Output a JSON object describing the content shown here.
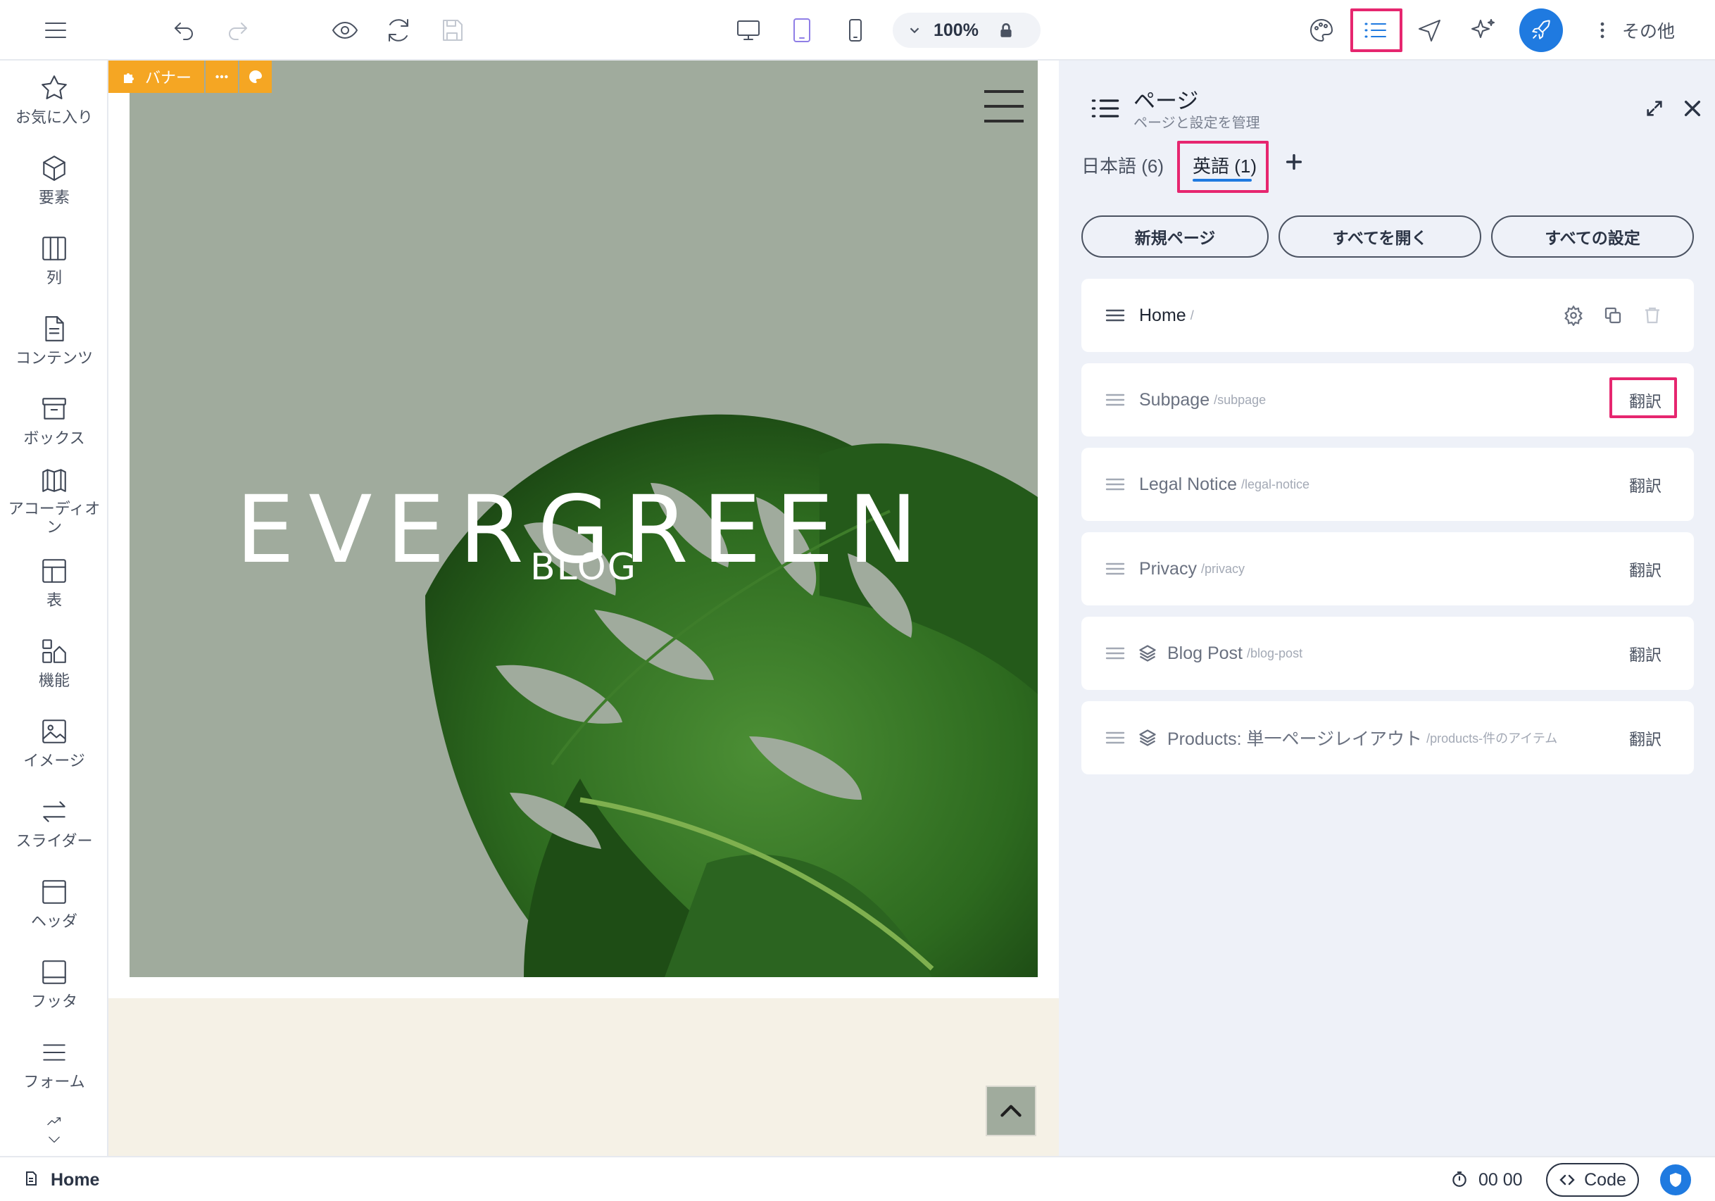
{
  "toolbar": {
    "zoom": "100%",
    "more_label": "その他"
  },
  "sidebar": {
    "items": [
      {
        "label": "お気に入り",
        "icon": "star-icon"
      },
      {
        "label": "要素",
        "icon": "cube-icon"
      },
      {
        "label": "列",
        "icon": "columns-icon"
      },
      {
        "label": "コンテンツ",
        "icon": "document-icon"
      },
      {
        "label": "ボックス",
        "icon": "archive-box-icon"
      },
      {
        "label": "アコーディオン",
        "icon": "accordion-icon"
      },
      {
        "label": "表",
        "icon": "table-icon"
      },
      {
        "label": "機能",
        "icon": "features-icon"
      },
      {
        "label": "イメージ",
        "icon": "image-icon"
      },
      {
        "label": "スライダー",
        "icon": "slider-arrows-icon"
      },
      {
        "label": "ヘッダ",
        "icon": "header-icon"
      },
      {
        "label": "フッタ",
        "icon": "footer-icon"
      },
      {
        "label": "フォーム",
        "icon": "form-lines-icon"
      }
    ]
  },
  "canvas": {
    "element_tag": "バナー",
    "banner_title": "EVERGREEN",
    "banner_subtitle": "BLOG"
  },
  "panel": {
    "title": "ページ",
    "subtitle": "ページと設定を管理",
    "tabs": [
      {
        "label": "日本語 (6)",
        "active": false
      },
      {
        "label": "英語 (1)",
        "active": true
      }
    ],
    "buttons": {
      "new_page": "新規ページ",
      "open_all": "すべてを開く",
      "all_settings": "すべての設定"
    },
    "pages": [
      {
        "name": "Home",
        "slug": "/",
        "action": ""
      },
      {
        "name": "Subpage",
        "slug": "/subpage",
        "action": "翻訳"
      },
      {
        "name": "Legal Notice",
        "slug": "/legal-notice",
        "action": "翻訳"
      },
      {
        "name": "Privacy",
        "slug": "/privacy",
        "action": "翻訳"
      },
      {
        "name": "Blog Post",
        "slug": "/blog-post",
        "action": "翻訳"
      },
      {
        "name": "Products: 単一ページレイアウト",
        "slug": "/products-件のアイテム",
        "action": "翻訳"
      }
    ]
  },
  "footer": {
    "page": "Home",
    "timer": "00 00",
    "code_label": "Code"
  },
  "colors": {
    "highlight": "#e6266f",
    "accent": "#1f7ae0",
    "tag": "#f5a623",
    "banner_bg": "#a0ab9d",
    "panel_bg": "#eef1f8"
  }
}
